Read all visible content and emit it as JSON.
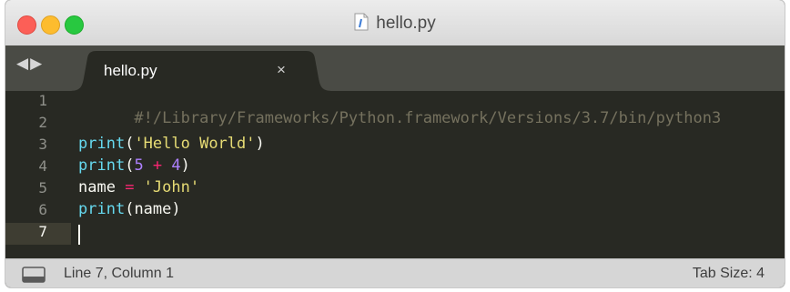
{
  "window": {
    "title": "hello.py"
  },
  "tabs": [
    {
      "label": "hello.py",
      "close": "×",
      "active": true
    }
  ],
  "nav": {
    "back": "◀",
    "forward": "▶"
  },
  "editor": {
    "line_numbers": [
      "1",
      "2",
      "3",
      "4",
      "5",
      "6",
      "7"
    ],
    "active_line": 7,
    "lines": {
      "l1": {
        "comment": "#!/Library/Frameworks/Python.framework/Versions/3.7/bin/python3"
      },
      "l3": {
        "fn": "print",
        "open": "(",
        "str": "'Hello World'",
        "close": ")"
      },
      "l4": {
        "fn": "print",
        "open": "(",
        "num1": "5",
        "op": " + ",
        "num2": "4",
        "close": ")"
      },
      "l5": {
        "var": "name",
        "op": " = ",
        "str": "'John'"
      },
      "l6": {
        "fn": "print",
        "open": "(",
        "arg": "name",
        "close": ")"
      }
    }
  },
  "status": {
    "position": "Line 7, Column 1",
    "tab_size": "Tab Size: 4"
  },
  "colors": {
    "editor_bg": "#282923",
    "comment": "#75715e",
    "function": "#66d9ef",
    "string": "#e6db74",
    "number": "#ae81ff",
    "operator": "#f92672"
  },
  "icons": {
    "file": "python-file-icon",
    "panel": "panel-toggle-icon"
  }
}
